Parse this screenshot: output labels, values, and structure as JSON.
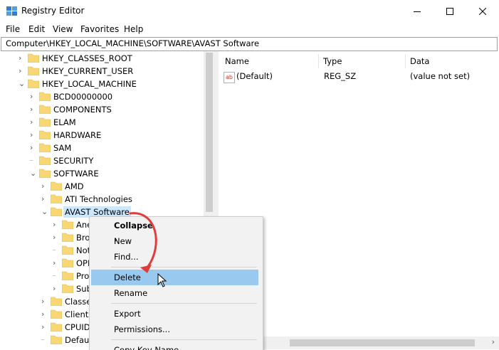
{
  "window": {
    "title": "Registry Editor"
  },
  "menubar": [
    "File",
    "Edit",
    "View",
    "Favorites",
    "Help"
  ],
  "address": {
    "value": "Computer\\HKEY_LOCAL_MACHINE\\SOFTWARE\\AVAST Software"
  },
  "tree": [
    {
      "label": "HKEY_CLASSES_ROOT",
      "depth": 0,
      "expander": "collapsed"
    },
    {
      "label": "HKEY_CURRENT_USER",
      "depth": 0,
      "expander": "collapsed"
    },
    {
      "label": "HKEY_LOCAL_MACHINE",
      "depth": 0,
      "expander": "expanded"
    },
    {
      "label": "BCD00000000",
      "depth": 1,
      "expander": "collapsed"
    },
    {
      "label": "COMPONENTS",
      "depth": 1,
      "expander": "collapsed"
    },
    {
      "label": "ELAM",
      "depth": 1,
      "expander": "collapsed"
    },
    {
      "label": "HARDWARE",
      "depth": 1,
      "expander": "collapsed"
    },
    {
      "label": "SAM",
      "depth": 1,
      "expander": "collapsed"
    },
    {
      "label": "SECURITY",
      "depth": 1,
      "expander": "none"
    },
    {
      "label": "SOFTWARE",
      "depth": 1,
      "expander": "expanded"
    },
    {
      "label": "AMD",
      "depth": 2,
      "expander": "collapsed"
    },
    {
      "label": "ATI Technologies",
      "depth": 2,
      "expander": "collapsed"
    },
    {
      "label": "AVAST Software",
      "depth": 2,
      "expander": "expanded",
      "selected": true
    },
    {
      "label": "Ane",
      "depth": 3,
      "expander": "collapsed"
    },
    {
      "label": "Bro",
      "depth": 3,
      "expander": "collapsed"
    },
    {
      "label": "Not",
      "depth": 3,
      "expander": "none"
    },
    {
      "label": "OPI",
      "depth": 3,
      "expander": "collapsed"
    },
    {
      "label": "Pro",
      "depth": 3,
      "expander": "none"
    },
    {
      "label": "Sub",
      "depth": 3,
      "expander": "collapsed"
    },
    {
      "label": "Classe",
      "depth": 2,
      "expander": "collapsed"
    },
    {
      "label": "Clients",
      "depth": 2,
      "expander": "collapsed"
    },
    {
      "label": "CPUID",
      "depth": 2,
      "expander": "collapsed"
    },
    {
      "label": "Defaul",
      "depth": 2,
      "expander": "none"
    }
  ],
  "list": {
    "columns": [
      "Name",
      "Type",
      "Data"
    ],
    "rows": [
      {
        "name": "(Default)",
        "type": "REG_SZ",
        "data": "(value not set)",
        "icon": "string-value-icon"
      }
    ]
  },
  "context_menu": {
    "items": [
      {
        "label": "Collapse",
        "bold": true
      },
      {
        "label": "New",
        "submenu": true
      },
      {
        "label": "Find..."
      },
      {
        "separator": true
      },
      {
        "label": "Delete",
        "highlighted": true
      },
      {
        "label": "Rename"
      },
      {
        "separator": true
      },
      {
        "label": "Export"
      },
      {
        "label": "Permissions..."
      },
      {
        "separator": true
      },
      {
        "label": "Copy Key Name"
      }
    ]
  },
  "colors": {
    "selection": "#cce8ff",
    "menu_highlight": "#99c9ef",
    "annotation_arrow": "#e03c3c",
    "folder": "#f8d775"
  }
}
